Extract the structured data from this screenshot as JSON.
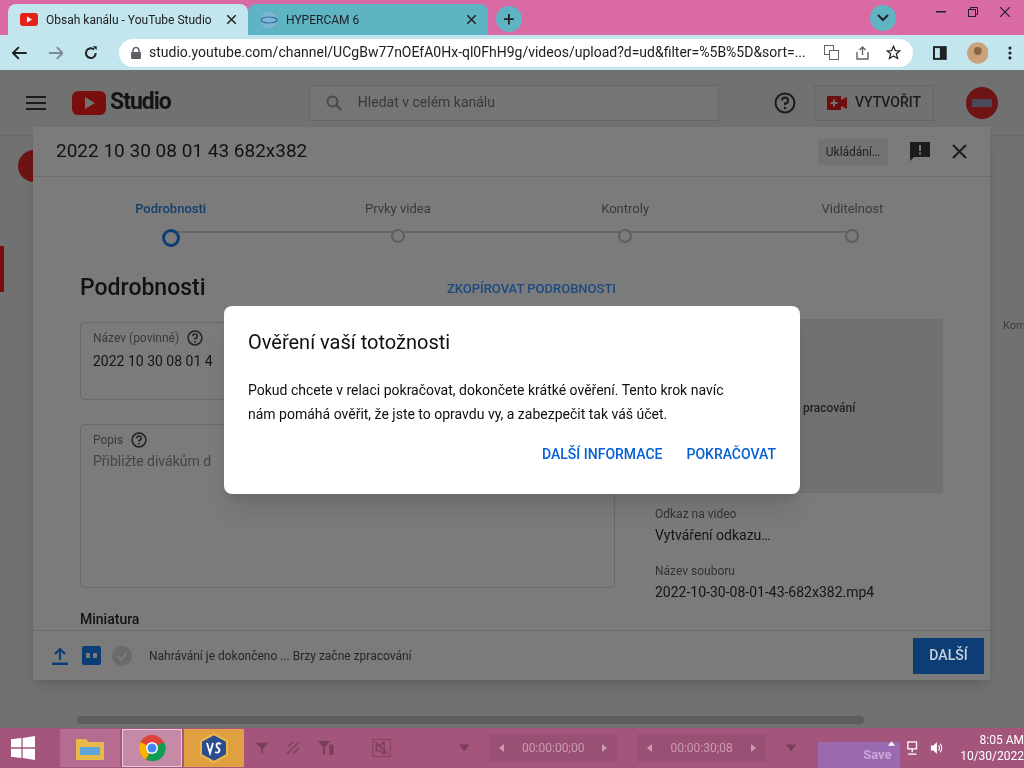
{
  "browser": {
    "tabs": [
      {
        "title": "Obsah kanálu - YouTube Studio",
        "selected": true,
        "kind": "youtube"
      },
      {
        "title": "HYPERCAM 6",
        "selected": false,
        "kind": "globe"
      }
    ],
    "new_tab": "+",
    "url": "studio.youtube.com/channel/UCgBw77nOEfA0Hx-ql0FhH9g/videos/upload?d=ud&filter=%5B%5D&sort=..."
  },
  "studio_header": {
    "logo": "Studio",
    "search_placeholder": "Hledat v celém kanálu",
    "create_button": "VYTVOŘIT"
  },
  "side_text": "Kom",
  "upload_dialog": {
    "title": "2022 10 30 08 01 43 682x382",
    "saving": "Ukládání…",
    "steps": [
      {
        "label": "Podrobnosti",
        "selected": true
      },
      {
        "label": "Prvky videa",
        "selected": false
      },
      {
        "label": "Kontroly",
        "selected": false
      },
      {
        "label": "Viditelnost",
        "selected": false
      }
    ],
    "section_title": "Podrobnosti",
    "copy_link": "ZKOPÍROVAT PODROBNOSTI",
    "title_field": {
      "label": "Název (povinné)",
      "value": "2022 10 30 08 01 4"
    },
    "description_field": {
      "label": "Popis",
      "placeholder": "Přibližte divákům d"
    },
    "thumbnail_heading": "Miniatura",
    "video_info": {
      "processing_text": "pracování",
      "link_label": "Odkaz na video",
      "link_value": "Vytváření odkazu…",
      "file_label": "Název souboru",
      "file_value": "2022-10-30-08-01-43-682x382.mp4"
    },
    "status": "Nahrávání je dokončeno ... Brzy začne zpracování",
    "next_button": "DALŠÍ"
  },
  "verify_dialog": {
    "title": "Ověření vaší totožnosti",
    "body": "Pokud chcete v relaci pokračovat, dokončete krátké ověření. Tento krok navíc nám pomáhá ověřit, že jste to opravdu vy, a zabezpečit tak váš účet.",
    "buttons": [
      "DALŠÍ INFORMACE",
      "POKRAČOVAT"
    ]
  },
  "taskbar": {
    "apps": [
      {
        "kind": "folder",
        "selected": false
      },
      {
        "kind": "chrome",
        "selected": true
      },
      {
        "kind": "vs",
        "selected": false
      }
    ],
    "times": [
      "00:00:00;00",
      "00:00:30;08"
    ],
    "save": "Save",
    "clock_time": "8:05 AM",
    "clock_date": "10/30/2022"
  }
}
